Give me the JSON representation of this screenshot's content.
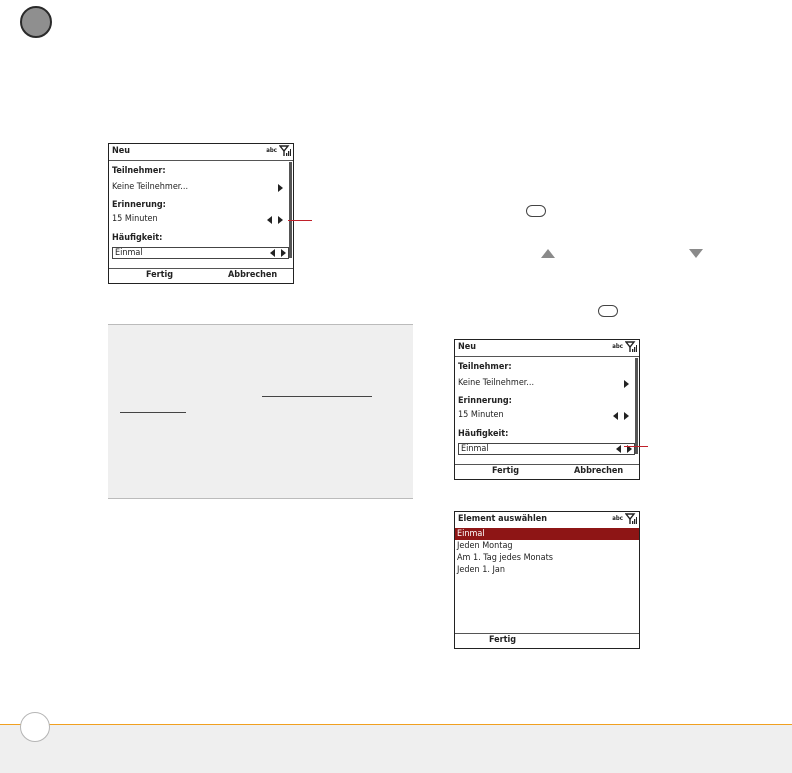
{
  "screen1": {
    "title": "Neu",
    "abc": "abc",
    "participants_label": "Teilnehmer:",
    "participants_value": "Keine Teilnehmer...",
    "reminder_label": "Erinnerung:",
    "reminder_value": "15 Minuten",
    "frequency_label": "Häufigkeit:",
    "frequency_value": "Einmal",
    "done_button": "Fertig",
    "cancel_button": "Abbrechen"
  },
  "screen2": {
    "title": "Neu",
    "abc": "abc",
    "participants_label": "Teilnehmer:",
    "participants_value": "Keine Teilnehmer...",
    "reminder_label": "Erinnerung:",
    "reminder_value": "15 Minuten",
    "frequency_label": "Häufigkeit:",
    "frequency_value": "Einmal",
    "done_button": "Fertig",
    "cancel_button": "Abbrechen"
  },
  "screen3": {
    "title": "Element auswählen",
    "abc": "abc",
    "items": [
      "Einmal",
      "Jeden Montag",
      "Am 1. Tag jedes Monats",
      "Jeden 1. Jan"
    ],
    "selected_index": 0,
    "done_button": "Fertig"
  },
  "colors": {
    "accent_red": "#c0202a",
    "selection": "#8e1515",
    "footer_rule": "#f0a020"
  }
}
